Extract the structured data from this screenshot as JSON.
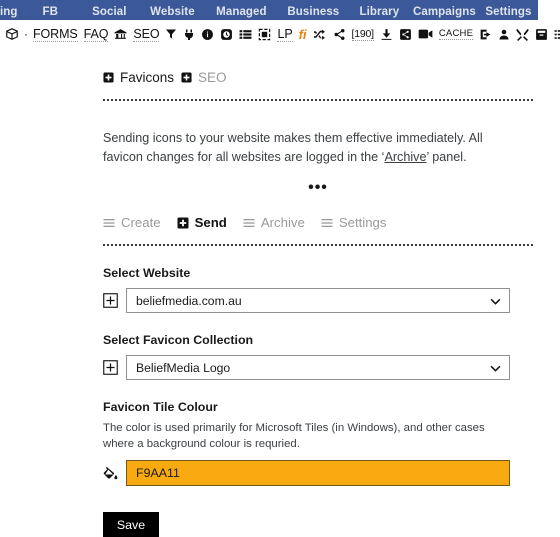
{
  "topnav": {
    "items": [
      {
        "label": "ing"
      },
      {
        "label": "FB"
      },
      {
        "label": "Social"
      },
      {
        "label": "Website"
      },
      {
        "label": "Managed"
      },
      {
        "label": "Business"
      },
      {
        "label": "Library"
      },
      {
        "label": "Campaigns"
      },
      {
        "label": "Settings"
      }
    ],
    "bg_color": "#3b5998"
  },
  "toolbar": {
    "items": [
      {
        "name": "box-icon",
        "kind": "icon",
        "label": ""
      },
      {
        "name": "dot-separator",
        "kind": "dot",
        "label": "·"
      },
      {
        "name": "forms-link",
        "kind": "text",
        "label": "FORMS"
      },
      {
        "name": "faq-link",
        "kind": "text",
        "label": "FAQ"
      },
      {
        "name": "bank-icon",
        "kind": "icon",
        "label": ""
      },
      {
        "name": "seo-link",
        "kind": "text",
        "label": "SEO"
      },
      {
        "name": "filter-icon",
        "kind": "icon",
        "label": ""
      },
      {
        "name": "plug-icon",
        "kind": "icon",
        "label": ""
      },
      {
        "name": "info-icon",
        "kind": "icon",
        "label": ""
      },
      {
        "name": "clock-icon",
        "kind": "icon",
        "label": ""
      },
      {
        "name": "list-icon",
        "kind": "icon",
        "label": ""
      },
      {
        "name": "crop-icon",
        "kind": "icon",
        "label": ""
      },
      {
        "name": "lp-link",
        "kind": "text",
        "label": "LP"
      },
      {
        "name": "fi-link",
        "kind": "fi",
        "label": "fi"
      },
      {
        "name": "shuffle-icon",
        "kind": "icon",
        "label": ""
      },
      {
        "name": "share-icon",
        "kind": "icon",
        "label": ""
      },
      {
        "name": "count-badge",
        "kind": "num",
        "label": "[190]"
      },
      {
        "name": "download-icon",
        "kind": "icon",
        "label": ""
      },
      {
        "name": "share-alt-icon",
        "kind": "icon",
        "label": ""
      },
      {
        "name": "video-icon",
        "kind": "icon",
        "label": ""
      },
      {
        "name": "cache-link",
        "kind": "cache",
        "label": "CACHE"
      },
      {
        "name": "import-icon",
        "kind": "icon",
        "label": ""
      },
      {
        "name": "user-icon",
        "kind": "icon",
        "label": ""
      },
      {
        "name": "tools-icon",
        "kind": "icon",
        "label": ""
      },
      {
        "name": "archive-icon",
        "kind": "icon",
        "label": ""
      },
      {
        "name": "bullet-list-icon",
        "kind": "icon",
        "label": ""
      },
      {
        "name": "pie-chart-icon",
        "kind": "icon",
        "label": ""
      }
    ]
  },
  "header": {
    "items": [
      {
        "label": "Favicons",
        "state": "active"
      },
      {
        "label": "SEO",
        "state": "muted"
      }
    ]
  },
  "intro": {
    "text_before": "Sending icons to your website makes them effective immediately. All favicon changes for all websites are logged in the ",
    "link_open": "‘",
    "link": "Archive",
    "link_close": "’",
    "text_after": " panel."
  },
  "ellipsis": "•••",
  "tabs": [
    {
      "label": "Create",
      "icon": "bars-icon",
      "state": "inactive"
    },
    {
      "label": "Send",
      "icon": "plus-square-icon",
      "state": "active"
    },
    {
      "label": "Archive",
      "icon": "bars-icon",
      "state": "inactive"
    },
    {
      "label": "Settings",
      "icon": "bars-icon",
      "state": "inactive"
    }
  ],
  "form": {
    "website": {
      "label": "Select Website",
      "value": "beliefmedia.com.au",
      "icon": "plus-square-outline-icon"
    },
    "collection": {
      "label": "Select Favicon Collection",
      "value": "BeliefMedia Logo",
      "icon": "plus-square-outline-icon"
    },
    "tile_colour": {
      "label": "Favicon Tile Colour",
      "help": "The color is used primarily for Microsoft Tiles (in Windows), and other cases where a background colour is requried.",
      "value": "F9AA11",
      "swatch_color": "#F9AA11",
      "icon": "fill-drip-icon"
    },
    "save_label": "Save"
  }
}
